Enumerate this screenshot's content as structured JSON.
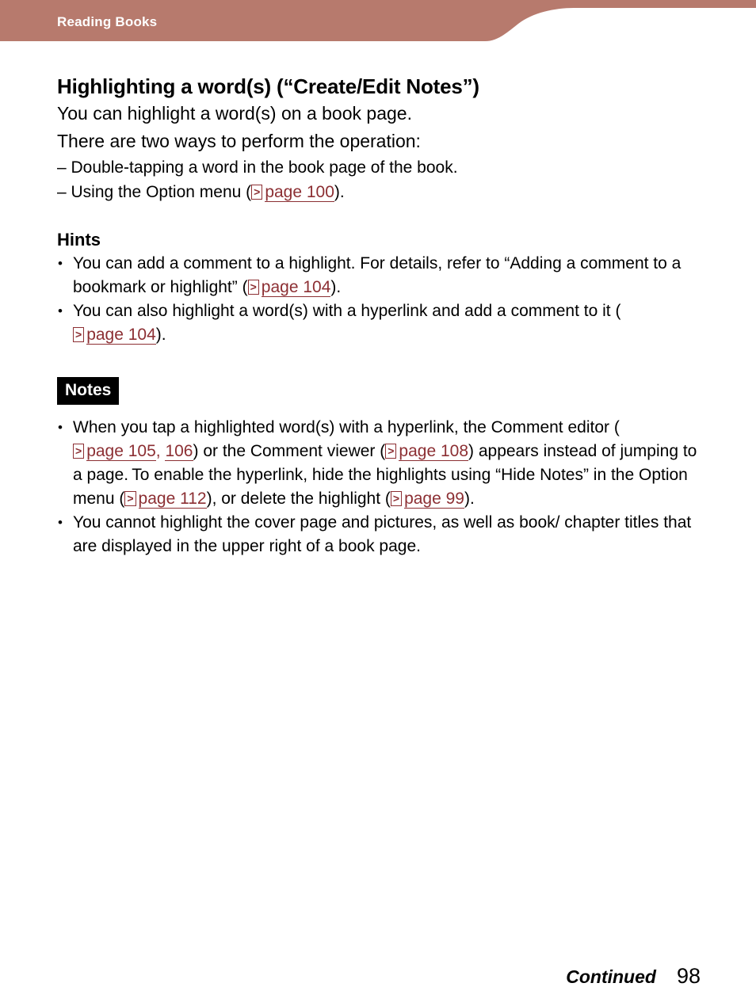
{
  "header": {
    "title": "Reading Books",
    "band_color": "#B77A6D"
  },
  "document": {
    "heading": "Highlighting a word(s) (“Create/Edit Notes”)",
    "lead_lines": [
      "You can highlight a word(s) on a book page.",
      "There are two ways to perform the operation:"
    ],
    "dash_items": {
      "first": "– Double-tapping a word in the book page of the book.",
      "second_prefix": "– Using the Option menu (",
      "second_suffix": ")."
    },
    "hints": {
      "title": "Hints",
      "item1_part1": "You can add a comment to a highlight. For details, refer to “Adding a comment to a bookmark or highlight” (",
      "item1_part2": ").",
      "item2_part1": "You can also highlight a word(s) with a hyperlink and add a comment to it (",
      "item2_part2": ")."
    },
    "notes": {
      "badge": "Notes",
      "item1_part1": "When you tap a highlighted word(s) with a hyperlink, the Comment editor (",
      "item1_part2": ", ",
      "item1_part3": ") or the Comment viewer (",
      "item1_part4": ") appears instead of jumping to a page. To enable the hyperlink, hide the highlights using “Hide Notes” in the Option menu (",
      "item1_part5": "), or delete the highlight (",
      "item1_part6": ").",
      "item2": "You cannot highlight the cover page and pictures, as well as book/ chapter titles that are displayed in the upper right of a book page."
    }
  },
  "page_refs": {
    "icon_glyph": ">",
    "link_color": "#8C2F33",
    "p100": "page 100",
    "p104_a": "page 104",
    "p104_b": "page 104",
    "p105": "page 105",
    "p106": "106",
    "p108": "page 108",
    "p112": "page 112",
    "p99": "page 99"
  },
  "footer": {
    "continued": "Continued",
    "page_number": "98"
  }
}
